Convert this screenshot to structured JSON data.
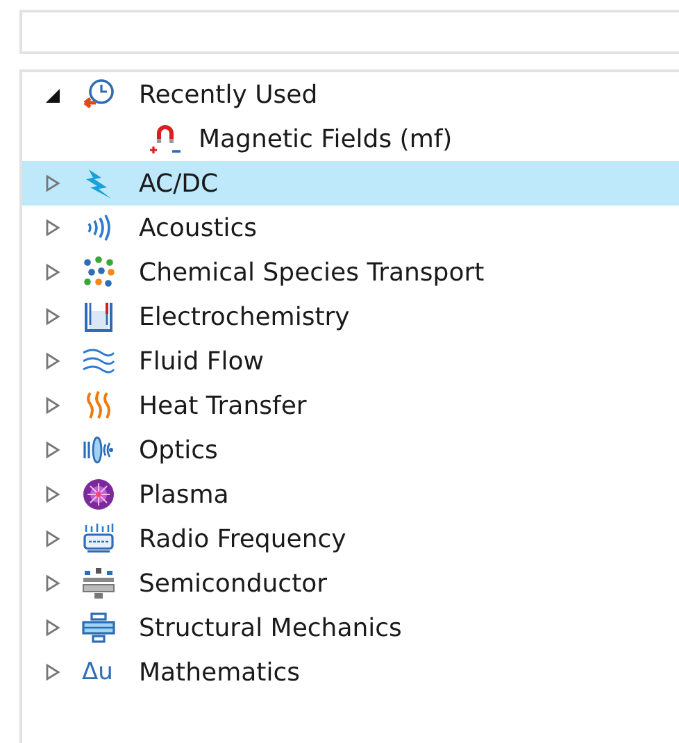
{
  "tree": [
    {
      "label": "Recently Used",
      "kind": "clock",
      "expanded": true,
      "selected": false,
      "children": [
        {
          "label": "Magnetic Fields (mf)",
          "kind": "magnet",
          "selected": false
        }
      ]
    },
    {
      "label": "AC/DC",
      "kind": "bolt",
      "expanded": false,
      "selected": true
    },
    {
      "label": "Acoustics",
      "kind": "waves",
      "expanded": false,
      "selected": false
    },
    {
      "label": "Chemical Species Transport",
      "kind": "dots",
      "expanded": false,
      "selected": false
    },
    {
      "label": "Electrochemistry",
      "kind": "beaker",
      "expanded": false,
      "selected": false
    },
    {
      "label": "Fluid Flow",
      "kind": "flow",
      "expanded": false,
      "selected": false
    },
    {
      "label": "Heat Transfer",
      "kind": "heat",
      "expanded": false,
      "selected": false
    },
    {
      "label": "Optics",
      "kind": "lens",
      "expanded": false,
      "selected": false
    },
    {
      "label": "Plasma",
      "kind": "plasma",
      "expanded": false,
      "selected": false
    },
    {
      "label": "Radio Frequency",
      "kind": "antenna",
      "expanded": false,
      "selected": false
    },
    {
      "label": "Semiconductor",
      "kind": "chip",
      "expanded": false,
      "selected": false
    },
    {
      "label": "Structural Mechanics",
      "kind": "beam",
      "expanded": false,
      "selected": false
    },
    {
      "label": "Mathematics",
      "kind": "math",
      "icon_text": "Δu",
      "expanded": false,
      "selected": false
    }
  ]
}
